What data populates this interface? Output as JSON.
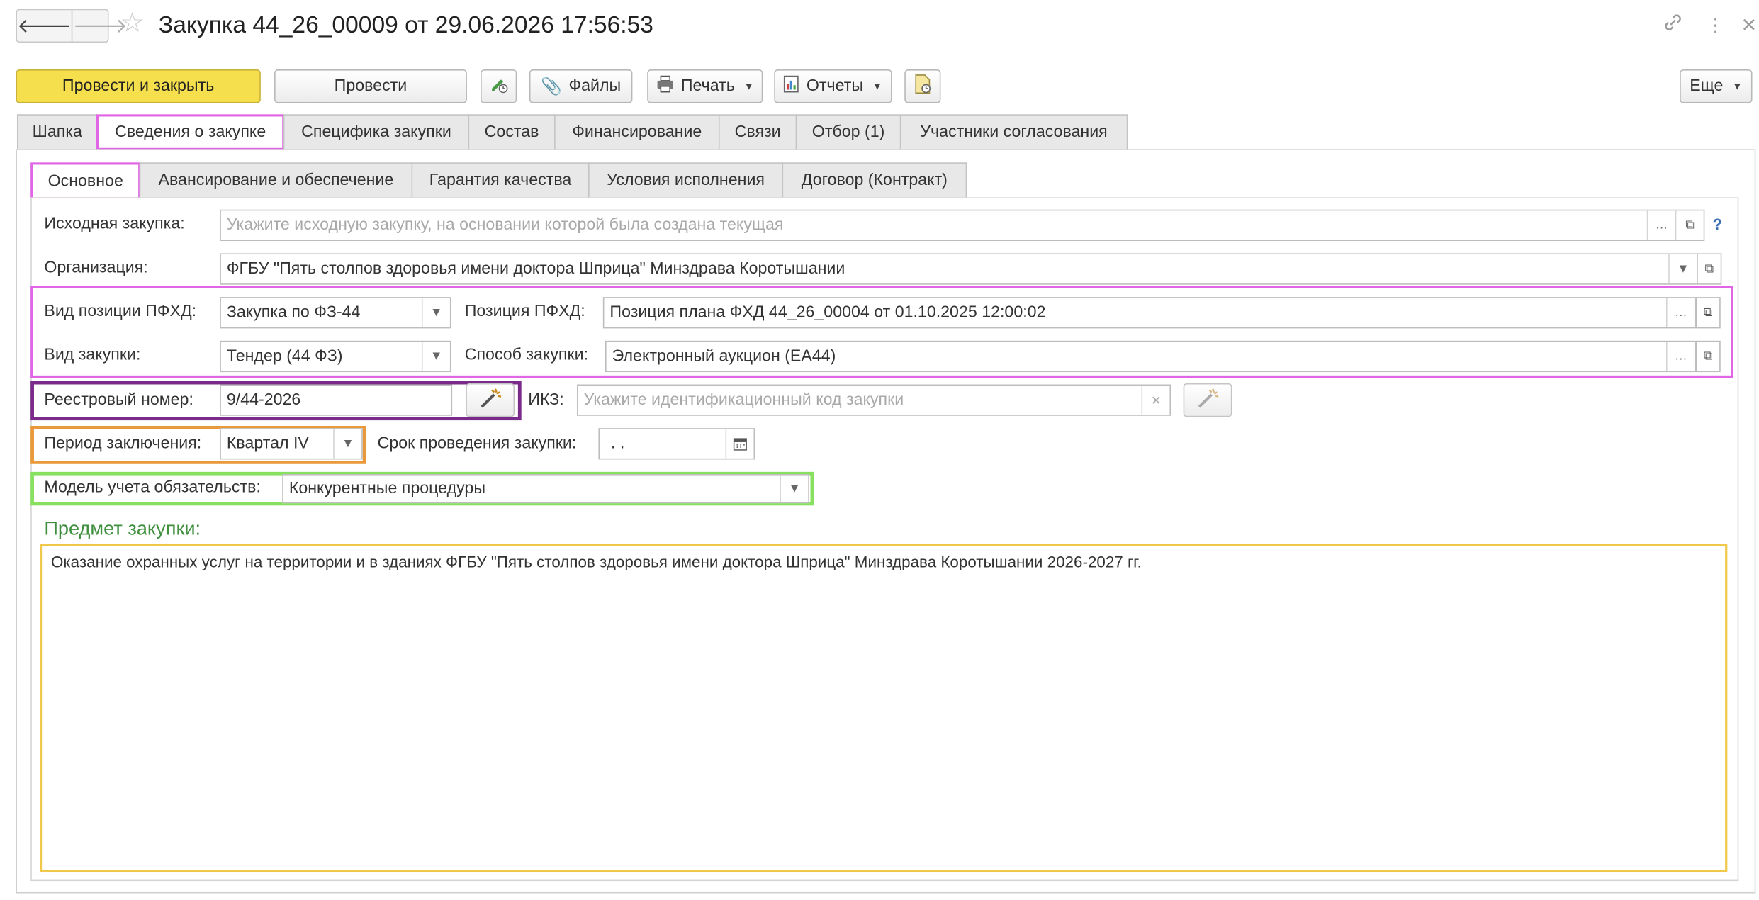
{
  "header": {
    "title": "Закупка 44_26_00009 от 29.06.2026 17:56:53",
    "back": "🡐",
    "forward": "🡒"
  },
  "toolbar": {
    "post_close": "Провести и закрыть",
    "post": "Провести",
    "files": "Файлы",
    "print": "Печать",
    "reports": "Отчеты",
    "more": "Еще"
  },
  "tabs": [
    {
      "label": "Шапка"
    },
    {
      "label": "Сведения о закупке"
    },
    {
      "label": "Специфика закупки"
    },
    {
      "label": "Состав"
    },
    {
      "label": "Финансирование"
    },
    {
      "label": "Связи"
    },
    {
      "label": "Отбор (1)"
    },
    {
      "label": "Участники согласования"
    }
  ],
  "subtabs": [
    {
      "label": "Основное"
    },
    {
      "label": "Авансирование и обеспечение"
    },
    {
      "label": "Гарантия качества"
    },
    {
      "label": "Условия исполнения"
    },
    {
      "label": "Договор (Контракт)"
    }
  ],
  "form": {
    "source_label": "Исходная закупка:",
    "source_placeholder": "Укажите исходную закупку, на основании которой была создана текущая",
    "org_label": "Организация:",
    "org_value": "ФГБУ \"Пять столпов здоровья имени доктора Шприца\" Минздрава Коротышании",
    "pfhd_type_label": "Вид позиции ПФХД:",
    "pfhd_type_value": "Закупка по ФЗ-44",
    "pfhd_pos_label": "Позиция ПФХД:",
    "pfhd_pos_value": "Позиция плана ФХД 44_26_00004 от 01.10.2025 12:00:02",
    "purchase_type_label": "Вид закупки:",
    "purchase_type_value": "Тендер (44 ФЗ)",
    "method_label": "Способ закупки:",
    "method_value": "Электронный аукцион (ЕА44)",
    "reg_label": "Реестровый номер:",
    "reg_value": "9/44-2026",
    "ikz_label": "ИКЗ:",
    "ikz_placeholder": "Укажите идентификационный код закупки",
    "period_label": "Период заключения:",
    "period_value": "Квартал IV",
    "term_label": "Срок проведения закупки:",
    "term_value": " .  .",
    "model_label": "Модель учета обязательств:",
    "model_value": "Конкурентные процедуры",
    "subject_label": "Предмет закупки:",
    "subject_value": "Оказание охранных услуг на территории и в зданиях ФГБУ \"Пять столпов здоровья имени доктора Шприца\" Минздрава Коротышании 2026-2027 гг."
  },
  "colors": {
    "highlight_pink": "#e066e6",
    "highlight_purple": "#7a2b8a",
    "highlight_orange": "#e9993b",
    "highlight_green": "#88e060",
    "highlight_yellow": "#f0c84a",
    "primary_button": "#f5df4d",
    "section_title": "#3f8f3f"
  }
}
